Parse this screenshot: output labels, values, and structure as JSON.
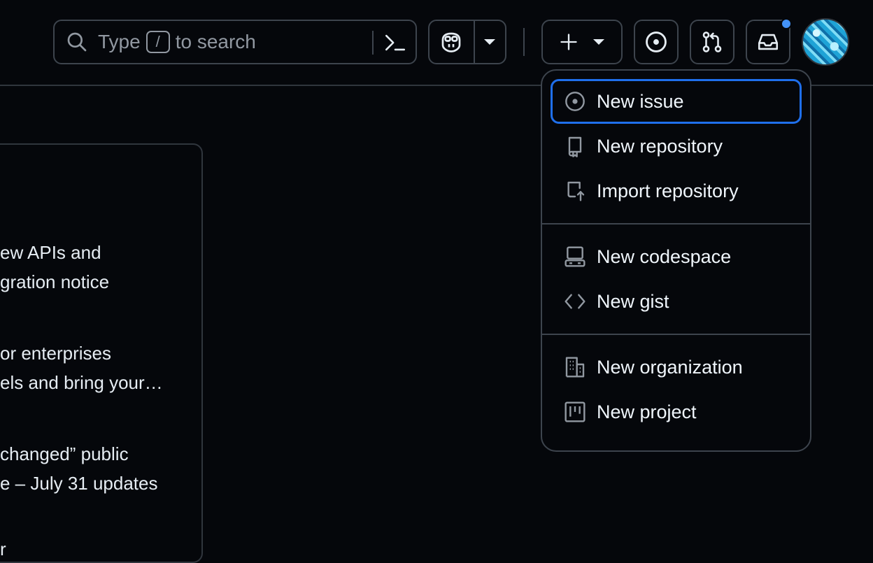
{
  "header": {
    "search": {
      "type_label": "Type",
      "key": "/",
      "suffix": "to search"
    },
    "create_label": "+",
    "notification_indicator_color": "#4493f8"
  },
  "background_panel": {
    "lines": [
      "ew APIs and",
      "gration notice",
      "or enterprises",
      "els and bring your…",
      "changed” public",
      "e – July 31 updates",
      "r"
    ]
  },
  "create_menu": {
    "groups": [
      [
        {
          "label": "New issue",
          "icon": "issue-opened-icon",
          "focused": true
        },
        {
          "label": "New repository",
          "icon": "repo-icon"
        },
        {
          "label": "Import repository",
          "icon": "repo-push-icon"
        }
      ],
      [
        {
          "label": "New codespace",
          "icon": "codespaces-icon"
        },
        {
          "label": "New gist",
          "icon": "code-icon"
        }
      ],
      [
        {
          "label": "New organization",
          "icon": "organization-icon"
        },
        {
          "label": "New project",
          "icon": "project-icon"
        }
      ]
    ],
    "items": {
      "new_issue": "New issue",
      "new_repository": "New repository",
      "import_repository": "Import repository",
      "new_codespace": "New codespace",
      "new_gist": "New gist",
      "new_organization": "New organization",
      "new_project": "New project"
    }
  },
  "colors": {
    "background": "#05070b",
    "border": "#3d444d",
    "focus_ring": "#1f6feb",
    "text": "#e6edf3",
    "muted": "#9198a1"
  }
}
